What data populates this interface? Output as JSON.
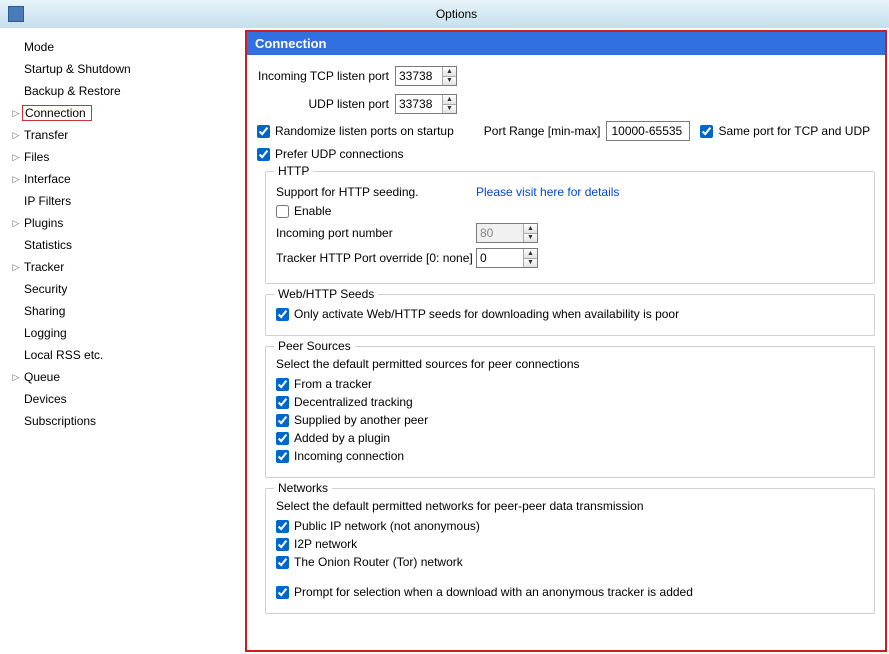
{
  "window": {
    "title": "Options",
    "app_icon": "vuze-icon"
  },
  "sidebar": {
    "items": [
      {
        "label": "Mode",
        "expandable": false
      },
      {
        "label": "Startup & Shutdown",
        "expandable": false
      },
      {
        "label": "Backup & Restore",
        "expandable": false
      },
      {
        "label": "Connection",
        "expandable": true,
        "selected": true
      },
      {
        "label": "Transfer",
        "expandable": true
      },
      {
        "label": "Files",
        "expandable": true
      },
      {
        "label": "Interface",
        "expandable": true
      },
      {
        "label": "IP Filters",
        "expandable": false
      },
      {
        "label": "Plugins",
        "expandable": true
      },
      {
        "label": "Statistics",
        "expandable": false
      },
      {
        "label": "Tracker",
        "expandable": true
      },
      {
        "label": "Security",
        "expandable": false
      },
      {
        "label": "Sharing",
        "expandable": false
      },
      {
        "label": "Logging",
        "expandable": false
      },
      {
        "label": "Local RSS etc.",
        "expandable": false
      },
      {
        "label": "Queue",
        "expandable": true
      },
      {
        "label": "Devices",
        "expandable": false
      },
      {
        "label": "Subscriptions",
        "expandable": false
      }
    ]
  },
  "panel": {
    "title": "Connection",
    "tcp_label": "Incoming TCP listen port",
    "tcp_value": "33738",
    "udp_label": "UDP listen port",
    "udp_value": "33738",
    "randomize": {
      "label": "Randomize listen ports on startup",
      "checked": true
    },
    "port_range_label": "Port Range [min-max]",
    "port_range_value": "10000-65535",
    "same_port": {
      "label": "Same port for TCP and UDP",
      "checked": true
    },
    "prefer_udp": {
      "label": "Prefer UDP connections",
      "checked": true
    },
    "http": {
      "legend": "HTTP",
      "support_text": "Support for HTTP seeding.",
      "details_link": "Please visit here for details",
      "enable": {
        "label": "Enable",
        "checked": false
      },
      "incoming_port_label": "Incoming port number",
      "incoming_port_value": "80",
      "override_label": "Tracker HTTP Port override [0: none]",
      "override_value": "0"
    },
    "web_seeds": {
      "legend": "Web/HTTP Seeds",
      "only_activate": {
        "label": "Only activate Web/HTTP seeds for downloading when availability is poor",
        "checked": true
      }
    },
    "peer_sources": {
      "legend": "Peer Sources",
      "desc": "Select the default permitted sources for peer connections",
      "from_tracker": {
        "label": "From a tracker",
        "checked": true
      },
      "decentralized": {
        "label": "Decentralized tracking",
        "checked": true
      },
      "supplied_peer": {
        "label": "Supplied by another peer",
        "checked": true
      },
      "added_plugin": {
        "label": "Added by a plugin",
        "checked": true
      },
      "incoming_conn": {
        "label": "Incoming connection",
        "checked": true
      }
    },
    "networks": {
      "legend": "Networks",
      "desc": "Select the default permitted networks for peer-peer data transmission",
      "public_ip": {
        "label": "Public IP network (not anonymous)",
        "checked": true
      },
      "i2p": {
        "label": "I2P network",
        "checked": true
      },
      "tor": {
        "label": "The Onion Router (Tor) network",
        "checked": true
      },
      "prompt": {
        "label": "Prompt for selection when a download with an anonymous tracker is added",
        "checked": true
      }
    }
  }
}
